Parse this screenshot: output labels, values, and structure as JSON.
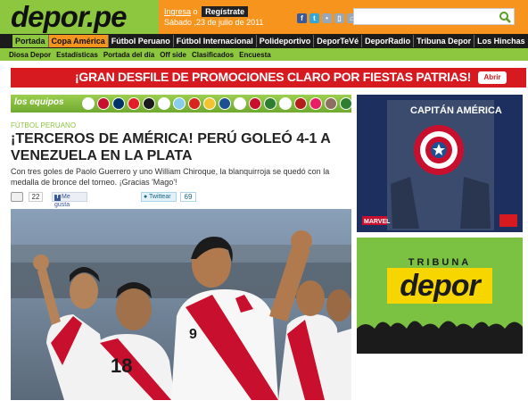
{
  "header": {
    "logo": "depor.pe",
    "login_label": "Ingresa",
    "or_label": "o",
    "register_label": "Regístrate",
    "date": "Sábado ,23 de julio de 2011",
    "search_placeholder": ""
  },
  "colors": {
    "brand_green": "#8dc63f",
    "brand_orange": "#f7941d",
    "nav_dark": "#1b1b1b",
    "promo_red": "#d71920"
  },
  "nav": {
    "items": [
      "Portada",
      "Copa América",
      "Fútbol Peruano",
      "Fútbol Internacional",
      "Polideportivo",
      "DeporTeVé",
      "DeporRadio",
      "Tribuna Depor",
      "Los Hinchas"
    ],
    "active": "Copa América"
  },
  "subnav": {
    "items": [
      "Diosa Depor",
      "Estadísticas",
      "Portada del día",
      "Off side",
      "Clasificados",
      "Encuesta"
    ]
  },
  "promo": {
    "text": "¡GRAN DESFILE DE PROMOCIONES CLARO POR FIESTAS PATRIAS!",
    "button": "Abrir"
  },
  "teams": {
    "label": "los equipos"
  },
  "article": {
    "section": "FÚTBOL PERUANO",
    "headline": "¡TERCEROS DE AMÉRICA! PERÚ GOLEÓ 4-1 A VENEZUELA EN LA PLATA",
    "summary": "Con tres goles de Paolo Guerrero y uno William Chiroque, la blanquirroja se quedó con la medalla de bronce del torneo. ¡Gracias 'Mago'!",
    "comment_count": "22",
    "fb_like_label": "Me gusta",
    "tweet_label": "Twittear",
    "tweet_count": "69"
  },
  "ads": {
    "ad1_title": "CAPITÁN AMÉRICA",
    "ad2_tribuna": "TRIBUNA",
    "ad2_depor": "depor"
  }
}
